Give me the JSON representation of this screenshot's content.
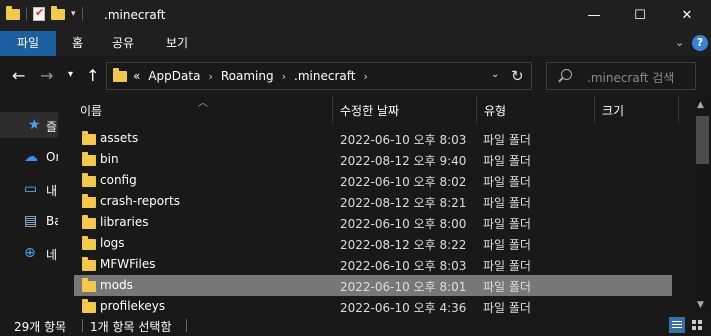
{
  "window": {
    "title": ".minecraft",
    "controls": {
      "minimize": "—",
      "maximize": "☐",
      "close": "✕"
    }
  },
  "ribbon": {
    "tabs": [
      "파일",
      "홈",
      "공유",
      "보기"
    ],
    "accent_color": "#1c5fa0"
  },
  "navigation": {
    "path": [
      "AppData",
      "Roaming",
      ".minecraft"
    ],
    "overflow": "«",
    "search_placeholder": ".minecraft 검색"
  },
  "nav_pane": {
    "items": [
      {
        "label": "즐",
        "icon": "star-icon"
      },
      {
        "label": "On",
        "icon": "cloud-icon"
      },
      {
        "label": "내",
        "icon": "pc-icon"
      },
      {
        "label": "Ba",
        "icon": "library-icon"
      },
      {
        "label": "네",
        "icon": "network-icon"
      }
    ]
  },
  "columns": {
    "name": "이름",
    "date": "수정한 날짜",
    "type": "유형",
    "size": "크기"
  },
  "files": [
    {
      "name": "assets",
      "date": "2022-06-10 오후 8:03",
      "type": "파일 폴더"
    },
    {
      "name": "bin",
      "date": "2022-08-12 오후 9:40",
      "type": "파일 폴더"
    },
    {
      "name": "config",
      "date": "2022-06-10 오후 8:02",
      "type": "파일 폴더"
    },
    {
      "name": "crash-reports",
      "date": "2022-08-12 오후 8:21",
      "type": "파일 폴더"
    },
    {
      "name": "libraries",
      "date": "2022-06-10 오후 8:00",
      "type": "파일 폴더"
    },
    {
      "name": "logs",
      "date": "2022-08-12 오후 8:22",
      "type": "파일 폴더"
    },
    {
      "name": "MFWFiles",
      "date": "2022-06-10 오후 8:03",
      "type": "파일 폴더"
    },
    {
      "name": "mods",
      "date": "2022-06-10 오후 8:01",
      "type": "파일 폴더",
      "selected": true
    },
    {
      "name": "profilekeys",
      "date": "2022-06-10 오후 4:36",
      "type": "파일 폴더"
    }
  ],
  "status": {
    "item_count": "29개 항목",
    "selected_count": "1개 항목 선택함"
  }
}
